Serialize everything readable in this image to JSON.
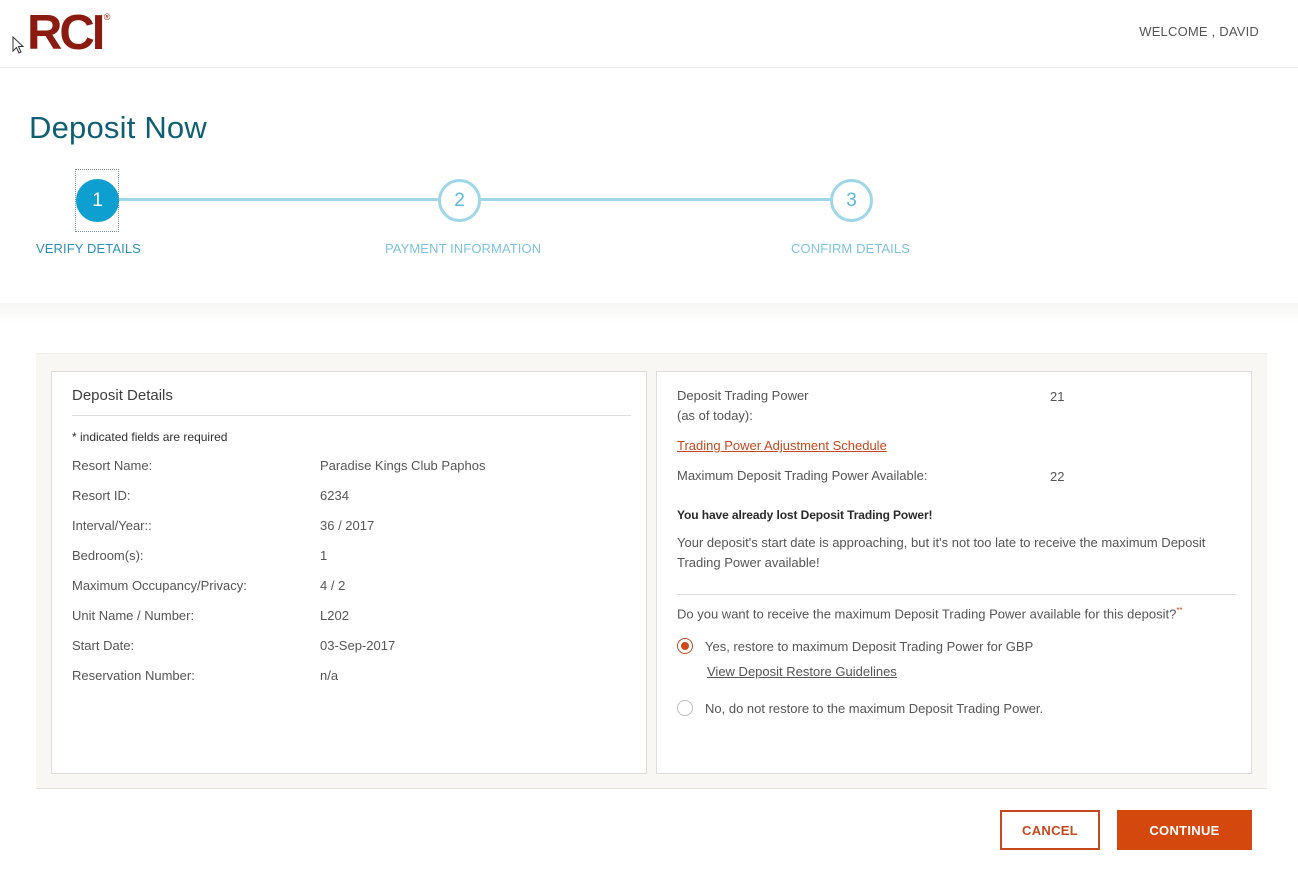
{
  "header": {
    "logo_text": "RCI",
    "logo_mark": "®",
    "welcome": "WELCOME , DAVID"
  },
  "page": {
    "title": "Deposit Now"
  },
  "stepper": {
    "current_step": 1,
    "steps": [
      {
        "number": "1",
        "label": "VERIFY DETAILS",
        "state": "active"
      },
      {
        "number": "2",
        "label": "PAYMENT INFORMATION",
        "state": "inactive"
      },
      {
        "number": "3",
        "label": "CONFIRM DETAILS",
        "state": "inactive"
      }
    ]
  },
  "deposit_details": {
    "title": "Deposit Details",
    "required_note": "* indicated fields are required",
    "rows": [
      {
        "label": "Resort Name:",
        "value": "Paradise Kings Club Paphos"
      },
      {
        "label": "Resort ID:",
        "value": "6234"
      },
      {
        "label": "Interval/Year::",
        "value": "36 / 2017"
      },
      {
        "label": "Bedroom(s):",
        "value": "1"
      },
      {
        "label": "Maximum Occupancy/Privacy:",
        "value": "4 / 2"
      },
      {
        "label": "Unit Name / Number:",
        "value": "L202"
      },
      {
        "label": "Start Date:",
        "value": "03-Sep-2017"
      },
      {
        "label": "Reservation Number:",
        "value": "n/a"
      }
    ]
  },
  "trading_power": {
    "current_label_line1": "Deposit Trading Power",
    "current_label_line2": "(as of today):",
    "current_value": "21",
    "schedule_link": "Trading Power Adjustment Schedule",
    "max_label": "Maximum Deposit Trading Power Available:",
    "max_value": "22",
    "warning_title": "You have already lost Deposit Trading Power!",
    "warning_body": "Your deposit's start date is approaching, but it's not too late to receive the maximum Deposit Trading Power available!",
    "question": "Do you want to receive the maximum Deposit Trading Power available for this deposit?",
    "question_marker": "**",
    "options": [
      {
        "label": "Yes, restore to maximum Deposit Trading Power for GBP",
        "checked": true
      },
      {
        "label": "No, do not restore to the maximum Deposit Trading Power.",
        "checked": false
      }
    ],
    "guidelines_link": "View Deposit Restore Guidelines"
  },
  "actions": {
    "cancel_label": "CANCEL",
    "continue_label": "CONTINUE"
  },
  "colors": {
    "brand_red": "#8b1a10",
    "title_teal": "#0f5f73",
    "step_active": "#0e9fd1",
    "step_inactive": "#9fd6e8",
    "accent_orange": "#d4480e"
  }
}
